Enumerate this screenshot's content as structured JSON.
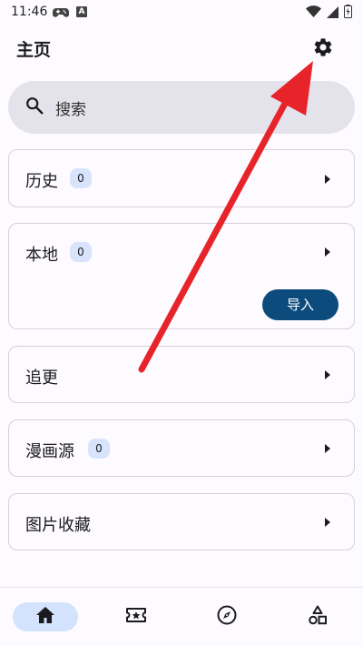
{
  "status_bar": {
    "time": "11:46",
    "a_badge": "A"
  },
  "header": {
    "title": "主页"
  },
  "search": {
    "placeholder": "搜索"
  },
  "cards": {
    "history": {
      "label": "历史",
      "count": "0"
    },
    "local": {
      "label": "本地",
      "count": "0",
      "import_label": "导入"
    },
    "following": {
      "label": "追更"
    },
    "comic_source": {
      "label": "漫画源",
      "count": "0"
    },
    "image_favorites": {
      "label": "图片收藏"
    }
  },
  "bottom_nav": {
    "items": [
      {
        "icon": "home-icon",
        "active": true
      },
      {
        "icon": "ticket-icon",
        "active": false
      },
      {
        "icon": "compass-icon",
        "active": false
      },
      {
        "icon": "category-icon",
        "active": false
      }
    ]
  },
  "colors": {
    "accent": "#0d4b7d",
    "badge_bg": "#d8e4fb",
    "search_bg": "#e4e2ea",
    "annotation_arrow": "#e8242b"
  }
}
